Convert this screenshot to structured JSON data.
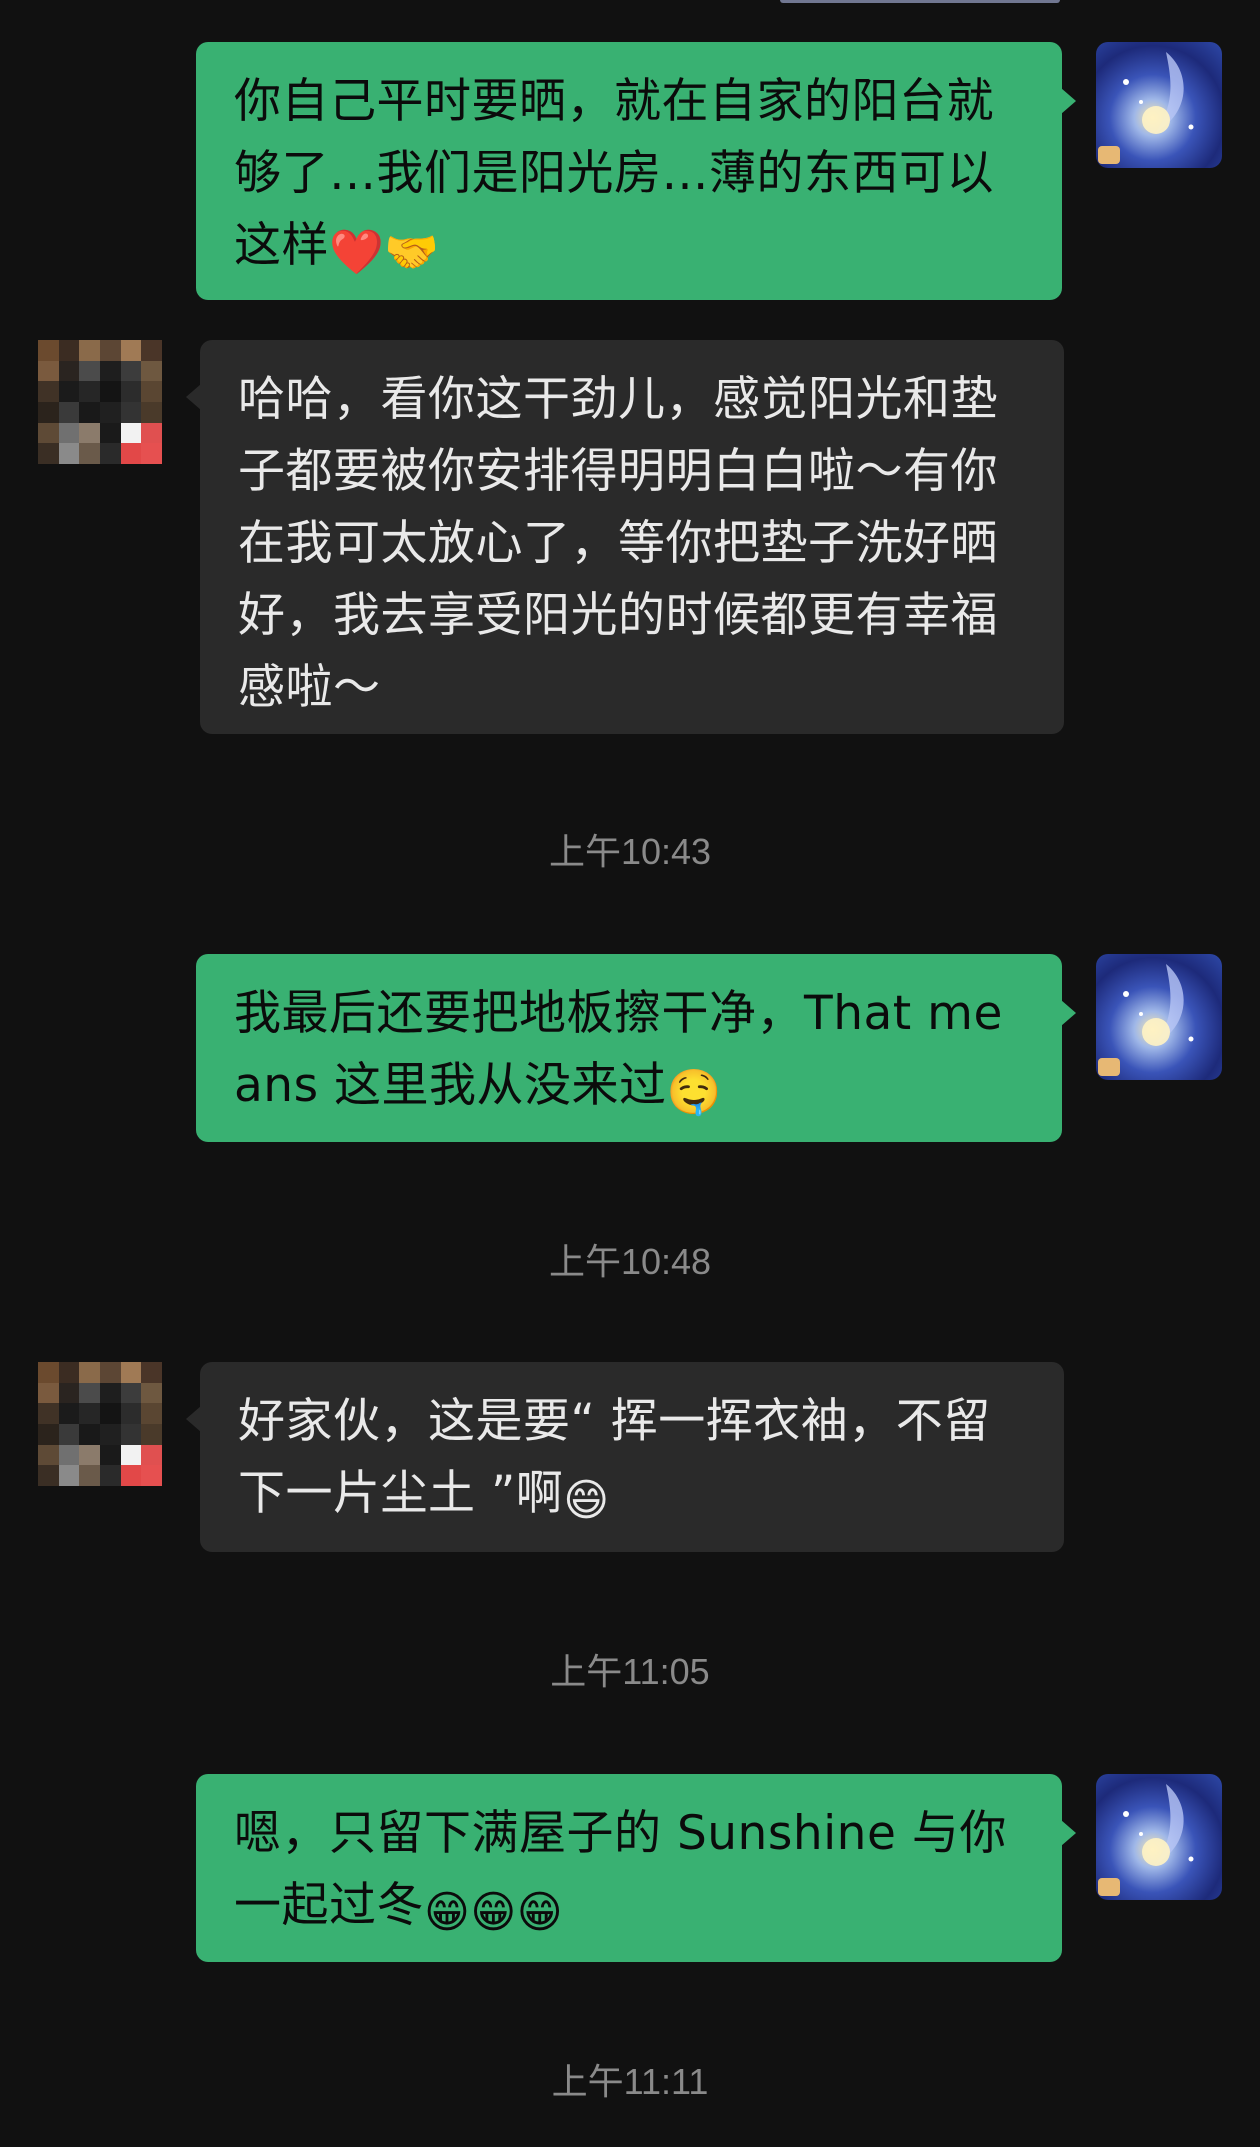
{
  "messages": [
    {
      "id": "m1",
      "sender": "me",
      "text": "你自己平时要晒，就在自家的阳台就够了…我们是阳光房…薄的东西可以这样",
      "emoji_tail": "❤️🤝"
    },
    {
      "id": "m2",
      "sender": "other",
      "text": "哈哈，看你这干劲儿，感觉阳光和垫子都要被你安排得明明白白啦～有你在我可太放心了，等你把垫子洗好晒好，我去享受阳光的时候都更有幸福感啦～"
    },
    {
      "id": "t1",
      "type": "timestamp",
      "text": "上午10:43"
    },
    {
      "id": "m3",
      "sender": "me",
      "text": "我最后还要把地板擦干净，That means 这里我从没来过",
      "emoji_tail": "🤤"
    },
    {
      "id": "t2",
      "type": "timestamp",
      "text": "上午10:48"
    },
    {
      "id": "m4",
      "sender": "other",
      "text": "好家伙，这是要“ 挥一挥衣袖，不留下一片尘土 ”啊",
      "emoji_tail": "😄"
    },
    {
      "id": "t3",
      "type": "timestamp",
      "text": "上午11:05"
    },
    {
      "id": "m5",
      "sender": "me",
      "text": "嗯，只留下满屋子的 Sunshine 与你一起过冬",
      "emoji_tail": "😁😁😁"
    },
    {
      "id": "t4",
      "type": "timestamp",
      "text": "上午11:11"
    }
  ],
  "colors": {
    "background": "#111111",
    "my_bubble": "#39b172",
    "other_bubble": "#2a2a2a",
    "timestamp_text": "#8a8a8a"
  },
  "icons": {
    "my_avatar": "anime-avatar-icon",
    "other_avatar": "pixelated-avatar-icon"
  }
}
